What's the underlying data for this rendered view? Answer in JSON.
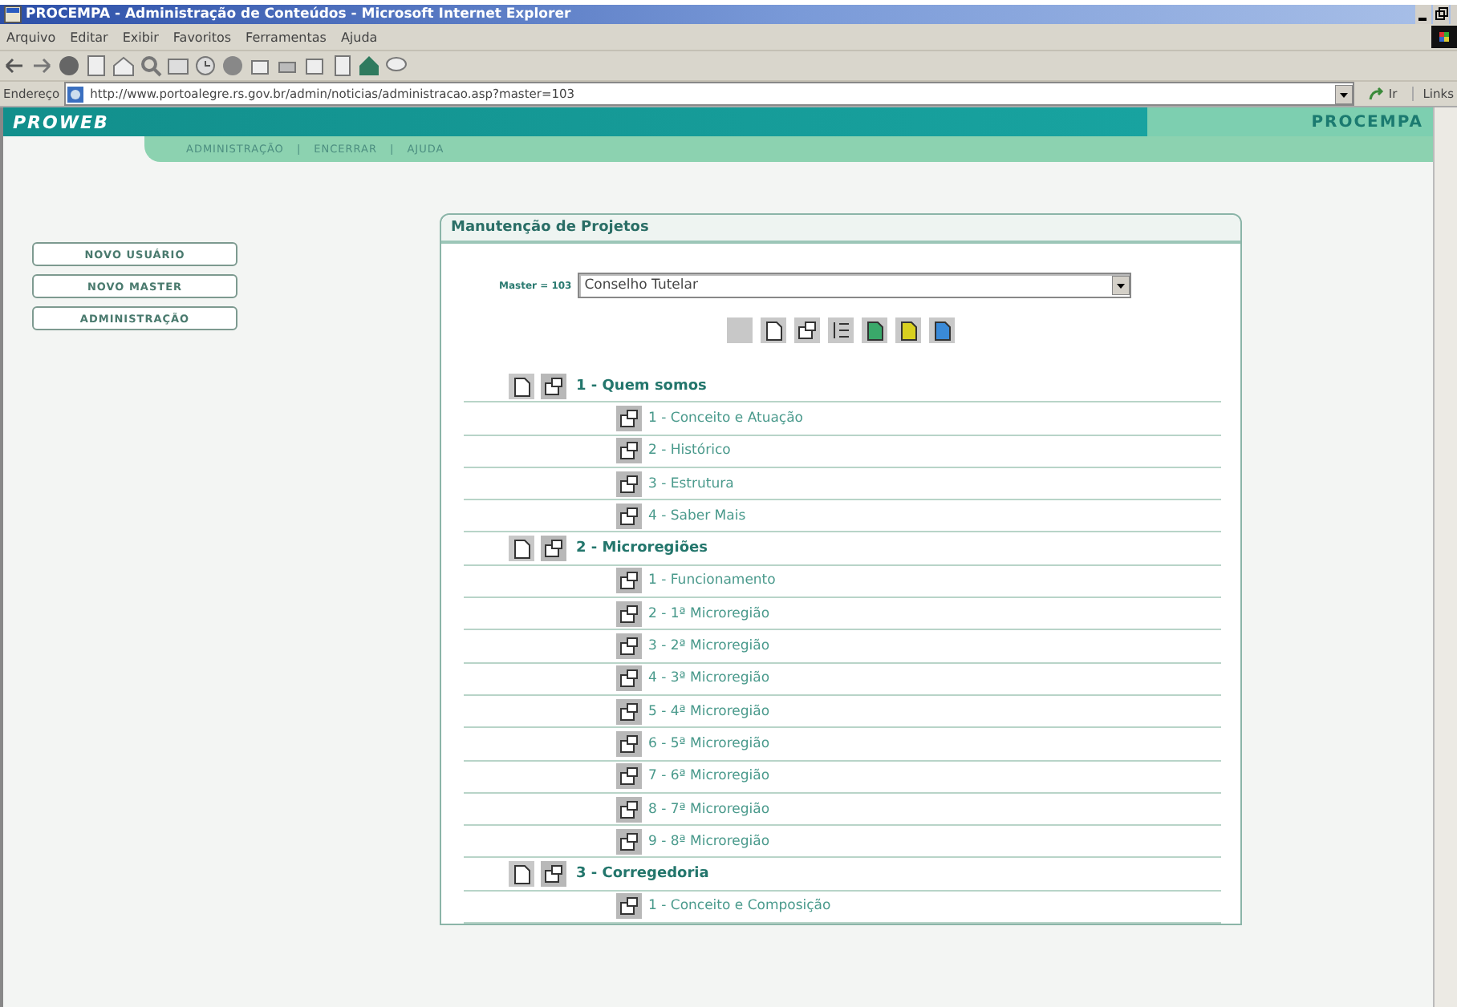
{
  "window": {
    "title": "PROCEMPA - Administração de Conteúdos - Microsoft Internet Explorer"
  },
  "menu": [
    "Arquivo",
    "Editar",
    "Exibir",
    "Favoritos",
    "Ferramentas",
    "Ajuda"
  ],
  "address_bar": {
    "label": "Endereço",
    "value": "http://www.portoalegre.rs.gov.br/admin/noticias/administracao.asp?master=103",
    "go": "Ir",
    "links": "Links"
  },
  "header": {
    "title": "PROWEB",
    "logo": "PROCEMPA"
  },
  "nav": {
    "items": [
      "ADMINISTRAÇÃO",
      "ENCERRAR",
      "AJUDA"
    ],
    "separator": "|"
  },
  "sidebar": {
    "buttons": [
      "NOVO USUÁRIO",
      "NOVO MASTER",
      "ADMINISTRAÇÃO"
    ]
  },
  "panel": {
    "title": "Manutenção de Projetos",
    "master_label": "Master = 103",
    "master_select": "Conselho Tutelar",
    "tree": [
      {
        "label": "1 - Quem somos",
        "children": [
          {
            "label": "1 - Conceito e Atuação"
          },
          {
            "label": "2 - Histórico"
          },
          {
            "label": "3 - Estrutura"
          },
          {
            "label": "4 - Saber Mais"
          }
        ]
      },
      {
        "label": "2 - Microregiões",
        "children": [
          {
            "label": "1 - Funcionamento"
          },
          {
            "label": "2 - 1ª Microregião"
          },
          {
            "label": "3 - 2ª Microregião"
          },
          {
            "label": "4 - 3ª Microregião"
          },
          {
            "label": "5 - 4ª Microregião"
          },
          {
            "label": "6 - 5ª Microregião"
          },
          {
            "label": "7 - 6ª Microregião"
          },
          {
            "label": "8 - 7ª Microregião"
          },
          {
            "label": "9 - 8ª Microregião"
          }
        ]
      },
      {
        "label": "3 - Corregedoria",
        "children": [
          {
            "label": "1 - Conceito e Composição"
          }
        ]
      }
    ]
  }
}
